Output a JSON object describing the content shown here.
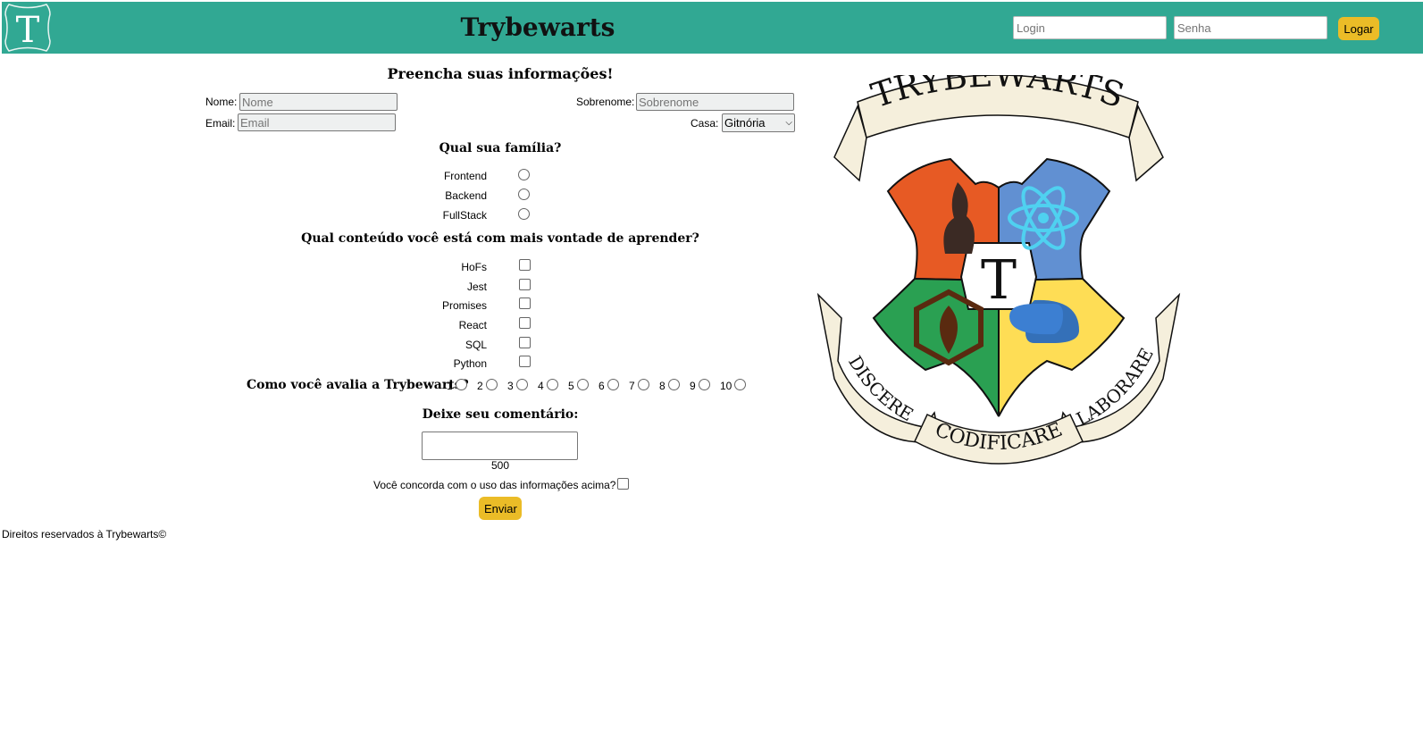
{
  "header": {
    "logo_letter": "T",
    "brand": "Trybewarts",
    "login_placeholder": "Login",
    "password_placeholder": "Senha",
    "login_button": "Logar",
    "bg_color": "#31a893",
    "button_color": "#ebbc27"
  },
  "form": {
    "title": "Preencha suas informações!",
    "name_label": "Nome:",
    "name_placeholder": "Nome",
    "surname_label": "Sobrenome:",
    "surname_placeholder": "Sobrenome",
    "email_label": "Email:",
    "email_placeholder": "Email",
    "house_label": "Casa:",
    "house_selected": "Gitnória",
    "family": {
      "title": "Qual sua família?",
      "options": [
        "Frontend",
        "Backend",
        "FullStack"
      ]
    },
    "content": {
      "title": "Qual conteúdo você está com mais vontade de aprender?",
      "options": [
        "HoFs",
        "Jest",
        "Promises",
        "React",
        "SQL",
        "Python"
      ]
    },
    "rating": {
      "title": "Como você avalia a Trybewarts?",
      "values": [
        "1",
        "2",
        "3",
        "4",
        "5",
        "6",
        "7",
        "8",
        "9",
        "10"
      ]
    },
    "comment": {
      "title": "Deixe seu comentário:",
      "counter": "500"
    },
    "agree_label": "Você concorda com o uso das informações acima?",
    "submit": "Enviar"
  },
  "crest": {
    "banner_top": "TRYBEWARTS",
    "center_letter": "T",
    "banner_left": "DISCERE",
    "banner_bottom": "CODIFICARE",
    "banner_right": "LABORARE"
  },
  "footer": {
    "text": "Direitos reservados à Trybewarts©"
  }
}
